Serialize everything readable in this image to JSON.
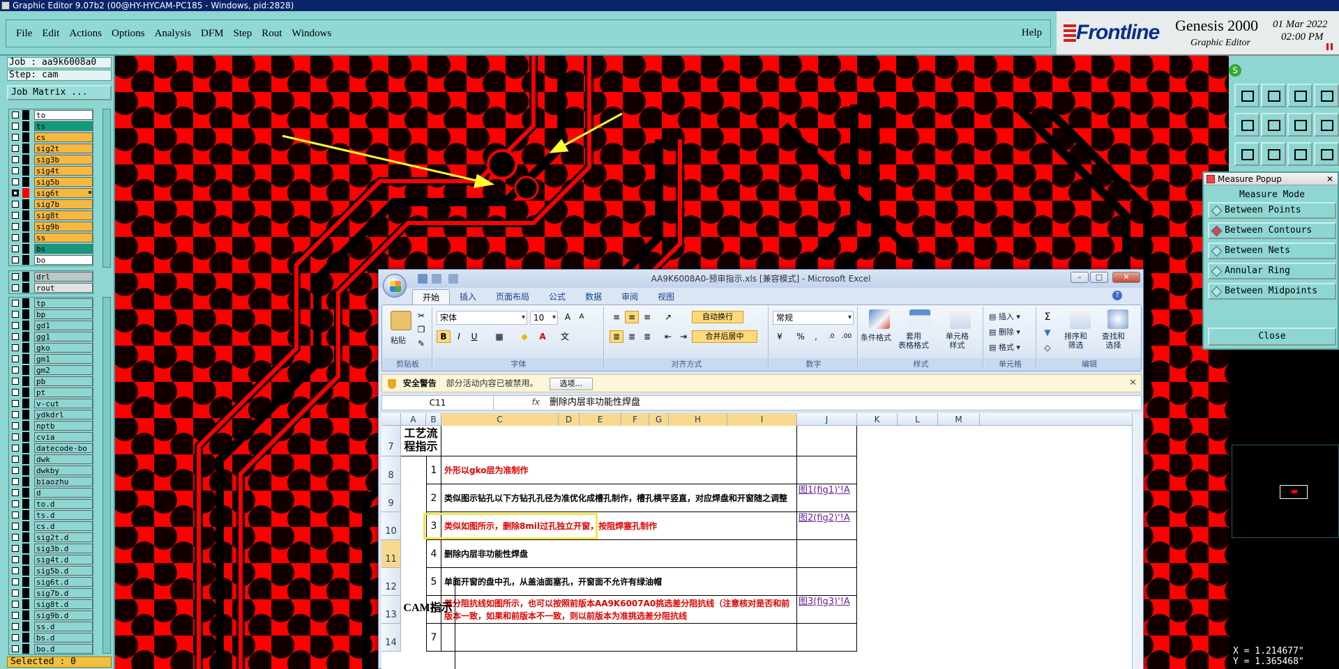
{
  "titlebar": {
    "text": "Graphic Editor 9.07b2 (00@HY-HYCAM-PC185 - Windows, pid:2828)"
  },
  "menu": {
    "items": [
      "File",
      "Edit",
      "Actions",
      "Options",
      "Analysis",
      "DFM",
      "Step",
      "Rout",
      "Windows"
    ],
    "help": "Help"
  },
  "brand": {
    "logo": "Frontline",
    "product": "Genesis 2000",
    "sub": "Graphic Editor",
    "date": "01 Mar 2022",
    "time": "02:00 PM"
  },
  "job": {
    "job_label": "Job : aa9k6008a0",
    "step_label": "Step: cam",
    "matrix_button": "Job Matrix ..."
  },
  "layers_group1": [
    {
      "name": "to",
      "color": "#ffffff",
      "cbcolor": "#000000"
    },
    {
      "name": "ts",
      "color": "#119a7c",
      "cbcolor": "#000000"
    },
    {
      "name": "cs",
      "color": "#f7b83d",
      "cbcolor": "#000000"
    },
    {
      "name": "sig2t",
      "color": "#f7b83d",
      "cbcolor": "#000000"
    },
    {
      "name": "sig3b",
      "color": "#f7b83d",
      "cbcolor": "#000000"
    },
    {
      "name": "sig4t",
      "color": "#f7b83d",
      "cbcolor": "#000000"
    },
    {
      "name": "sig5b",
      "color": "#f7b83d",
      "cbcolor": "#000000"
    },
    {
      "name": "sig6t",
      "color": "#f7b83d",
      "cbcolor": "#ff0000",
      "checked": true
    },
    {
      "name": "sig7b",
      "color": "#f7b83d",
      "cbcolor": "#000000"
    },
    {
      "name": "sig8t",
      "color": "#f7b83d",
      "cbcolor": "#000000"
    },
    {
      "name": "sig9b",
      "color": "#f7b83d",
      "cbcolor": "#000000"
    },
    {
      "name": "ss",
      "color": "#f7b83d",
      "cbcolor": "#000000"
    },
    {
      "name": "bs",
      "color": "#119a7c",
      "cbcolor": "#000000"
    },
    {
      "name": "bo",
      "color": "#ffffff",
      "cbcolor": "#000000"
    }
  ],
  "layers_group2": [
    {
      "name": "drl",
      "color": "#b9c8c8"
    },
    {
      "name": "rout",
      "color": "#e2e2e2"
    }
  ],
  "layers_group3": [
    "tp",
    "bp",
    "gd1",
    "gg1",
    "gko",
    "gm1",
    "gm2",
    "pb",
    "pt",
    "v-cut",
    "ydkdrl",
    "nptb",
    "cvia",
    "datecode-bo",
    "dwk",
    "dwkby",
    "biaozhu",
    "d",
    "to.d",
    "ts.d",
    "cs.d",
    "sig2t.d",
    "sig3b.d",
    "sig4t.d",
    "sig5b.d",
    "sig6t.d",
    "sig7b.d",
    "sig8t.d",
    "sig9b.d",
    "ss.d",
    "bs.d",
    "bo.d"
  ],
  "status": {
    "selected": "Selected : 0"
  },
  "measure": {
    "title": "Measure Popup",
    "mode": "Measure Mode",
    "options": [
      "Between Points",
      "Between Contours",
      "Between Nets",
      "Annular Ring",
      "Between Midpoints"
    ],
    "selected_index": 1,
    "close": "Close"
  },
  "coords": {
    "x": "X = 1.214677\"",
    "y": "Y = 1.365468\""
  },
  "excel": {
    "title": "AA9K6008A0-预审指示.xls  [兼容模式] - Microsoft Excel",
    "tabs": [
      "开始",
      "插入",
      "页面布局",
      "公式",
      "数据",
      "审阅",
      "视图"
    ],
    "ribbon": {
      "paste": "粘贴",
      "clipboard": "剪贴板",
      "font": "宋体",
      "size": "10",
      "font_group": "字体",
      "wrap": "自动换行",
      "merge": "合并后居中",
      "align_group": "对齐方式",
      "numfmt": "常规",
      "number_group": "数字",
      "percent": "%",
      "comma": ",",
      "cond": "条件格式",
      "table": "套用\n表格格式",
      "cellstyle": "单元格\n样式",
      "style_group": "样式",
      "insert": "插入",
      "delete": "删除",
      "format": "格式",
      "cells_group": "单元格",
      "sort": "排序和\n筛选",
      "find": "查找和\n选择",
      "edit_group": "编辑"
    },
    "security": {
      "title": "安全警告",
      "message": "部分活动内容已被禁用。",
      "button": "选项..."
    },
    "formula_bar": {
      "namebox": "C11",
      "fx": "fx",
      "value": "删除内层非功能性焊盘"
    },
    "columns": [
      "A",
      "B",
      "C",
      "D",
      "E",
      "F",
      "G",
      "H",
      "I",
      "J",
      "K",
      "L",
      "M"
    ],
    "rows": [
      {
        "num": "7",
        "a": "工艺流程指示",
        "b": "",
        "c": "",
        "j": ""
      },
      {
        "num": "8",
        "b": "1",
        "c": "外形以gko层为准制作",
        "red": true,
        "j": ""
      },
      {
        "num": "9",
        "b": "2",
        "c": "类似图示钻孔以下方钻孔孔径为准优化成槽孔制作，槽孔横平竖直，对应焊盘和开窗随之调整",
        "red": false,
        "j": "图1(fig1)'!A"
      },
      {
        "num": "10",
        "b": "3",
        "c": "类似如图所示，删除8mil过孔独立开窗，按阻焊塞孔制作",
        "red": true,
        "j": "图2(fig2)'!A"
      },
      {
        "num": "11",
        "b": "4",
        "c": "删除内层非功能性焊盘",
        "red": false,
        "j": ""
      },
      {
        "num": "12",
        "b": "5",
        "c": "单面开窗的盘中孔，从盖油面塞孔，开窗面不允许有绿油帽",
        "red": false,
        "j": ""
      },
      {
        "num": "13",
        "b": "6",
        "c": "差分阻抗线如图所示，也可以按照前版本AA9K6007A0挑选差分阻抗线（注意核对是否和前版本一致，如果和前版本不一致，则以前版本为准挑选差分阻抗线",
        "red": true,
        "j": "图3(fig3)'!A"
      },
      {
        "num": "14",
        "b": "7",
        "c": "",
        "red": false,
        "j": ""
      }
    ],
    "cam_label": "CAM指示"
  }
}
